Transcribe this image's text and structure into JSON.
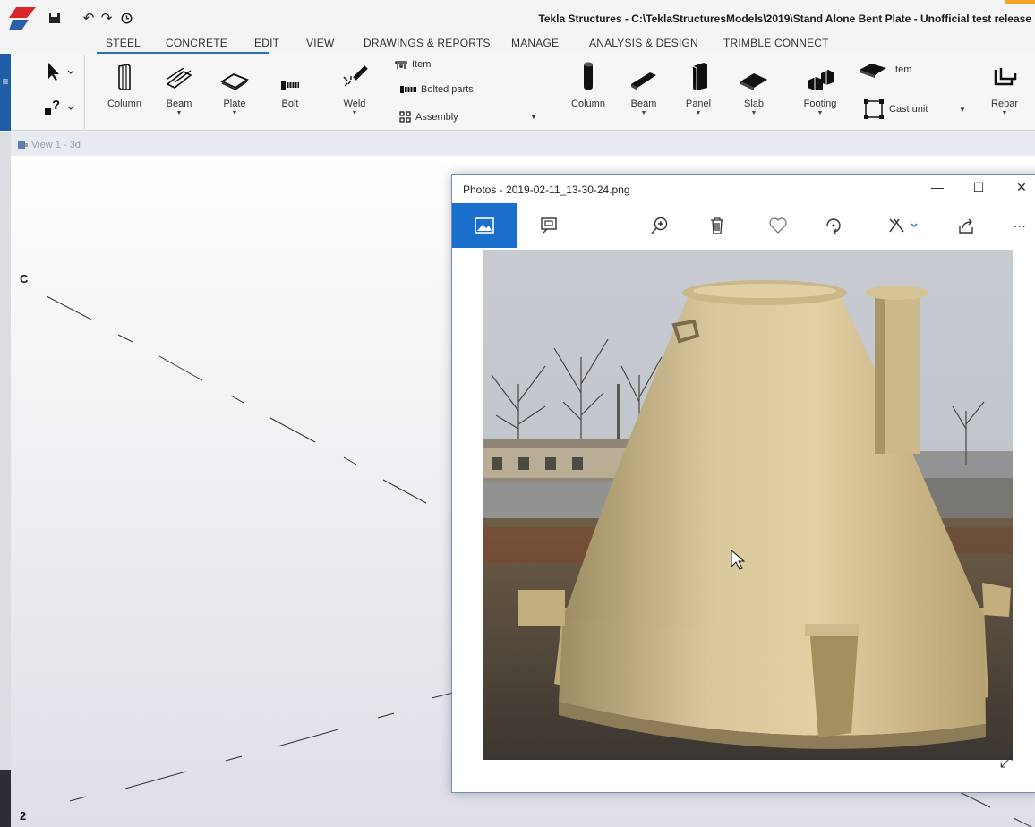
{
  "app": {
    "title": "Tekla Structures - C:\\TeklaStructuresModels\\2019\\Stand Alone Bent Plate  - Unofficial test release"
  },
  "tabs": [
    "STEEL",
    "CONCRETE",
    "EDIT",
    "VIEW",
    "DRAWINGS & REPORTS",
    "MANAGE",
    "ANALYSIS & DESIGN",
    "TRIMBLE CONNECT"
  ],
  "ribbon": {
    "menu_icon": "≡",
    "steel": {
      "column": "Column",
      "beam": "Beam",
      "plate": "Plate",
      "bolt": "Bolt",
      "weld": "Weld",
      "item": "Item",
      "bolted_parts": "Bolted parts",
      "assembly": "Assembly"
    },
    "concrete": {
      "column": "Column",
      "beam": "Beam",
      "panel": "Panel",
      "slab": "Slab",
      "footing": "Footing",
      "item": "Item",
      "cast_unit": "Cast unit",
      "rebar": "Rebar"
    }
  },
  "view": {
    "label": "View 1 - 3d",
    "grid_c": "C",
    "grid_2": "2"
  },
  "photos": {
    "title": "Photos - 2019-02-11_13-30-24.png",
    "minimize": "—",
    "maximize": "☐",
    "close": "✕",
    "more": "···"
  },
  "icons": [
    "tekla-logo",
    "save-icon",
    "undo-icon",
    "redo-icon",
    "history-icon",
    "select-arrow-icon",
    "help-icon",
    "image-view-icon",
    "slideshow-icon",
    "zoom-in-icon",
    "delete-icon",
    "favorite-icon",
    "rotate-icon",
    "edit-icon",
    "share-icon",
    "expand-icon"
  ],
  "colors": {
    "accent": "#1b6fcc",
    "menu_strip": "#1f5da8",
    "tekla_orange": "#f3a722",
    "tank": "#d9c38f"
  }
}
